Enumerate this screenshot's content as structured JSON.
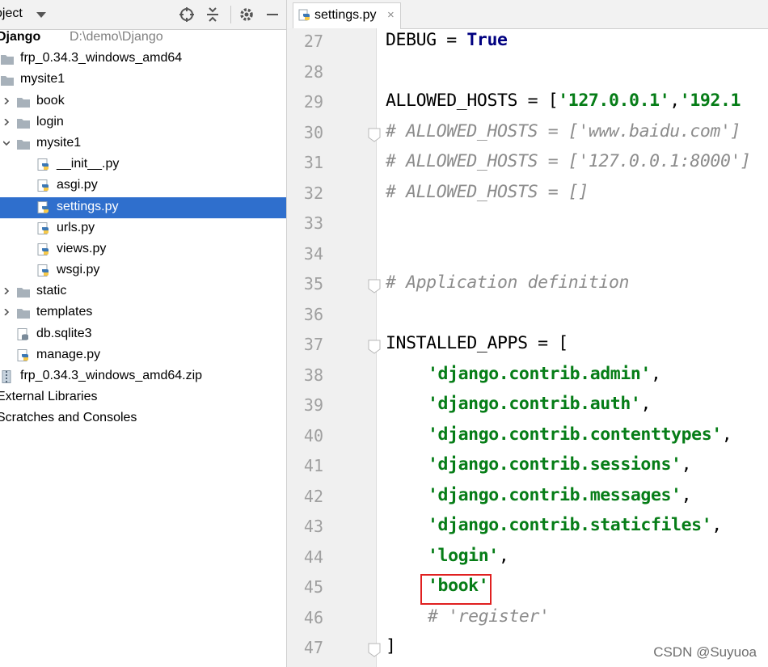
{
  "project_panel": {
    "title": "oject",
    "tree": [
      {
        "label": "Django",
        "hint": "D:\\demo\\Django",
        "level": 0,
        "type": "project",
        "arrow": "none"
      },
      {
        "label": "frp_0.34.3_windows_amd64",
        "level": 0,
        "type": "folder",
        "arrow": "none"
      },
      {
        "label": "mysite1",
        "level": 0,
        "type": "folder",
        "arrow": "none"
      },
      {
        "label": "book",
        "level": 1,
        "type": "folder",
        "arrow": "right"
      },
      {
        "label": "login",
        "level": 1,
        "type": "folder",
        "arrow": "right"
      },
      {
        "label": "mysite1",
        "level": 1,
        "type": "folder",
        "arrow": "down"
      },
      {
        "label": "__init__.py",
        "level": 2,
        "type": "python",
        "arrow": "none"
      },
      {
        "label": "asgi.py",
        "level": 2,
        "type": "python",
        "arrow": "none"
      },
      {
        "label": "settings.py",
        "level": 2,
        "type": "python",
        "arrow": "none",
        "selected": true
      },
      {
        "label": "urls.py",
        "level": 2,
        "type": "python",
        "arrow": "none"
      },
      {
        "label": "views.py",
        "level": 2,
        "type": "python",
        "arrow": "none"
      },
      {
        "label": "wsgi.py",
        "level": 2,
        "type": "python",
        "arrow": "none"
      },
      {
        "label": "static",
        "level": 1,
        "type": "folder",
        "arrow": "right"
      },
      {
        "label": "templates",
        "level": 1,
        "type": "folder",
        "arrow": "right"
      },
      {
        "label": "db.sqlite3",
        "level": 1,
        "type": "db",
        "arrow": "none"
      },
      {
        "label": "manage.py",
        "level": 1,
        "type": "python",
        "arrow": "none"
      },
      {
        "label": "frp_0.34.3_windows_amd64.zip",
        "level": 0,
        "type": "zip",
        "arrow": "none"
      },
      {
        "label": "External Libraries",
        "level": 0,
        "type": "none",
        "arrow": "none"
      },
      {
        "label": "Scratches and Consoles",
        "level": 0,
        "type": "none",
        "arrow": "none"
      }
    ]
  },
  "editor": {
    "tab_label": "settings.py",
    "tab_close": "×",
    "lines": [
      {
        "n": "27",
        "segs": [
          {
            "t": "DEBUG = ",
            "c": ""
          },
          {
            "t": "True",
            "c": "kw"
          }
        ]
      },
      {
        "n": "28",
        "segs": []
      },
      {
        "n": "29",
        "segs": [
          {
            "t": "ALLOWED_HOSTS = [",
            "c": ""
          },
          {
            "t": "'127.0.0.1'",
            "c": "str"
          },
          {
            "t": ",",
            "c": ""
          },
          {
            "t": "'192.1",
            "c": "str"
          }
        ]
      },
      {
        "n": "30",
        "fold": true,
        "segs": [
          {
            "t": "# ALLOWED_HOSTS = ['www.baidu.com']",
            "c": "cmt"
          }
        ]
      },
      {
        "n": "31",
        "segs": [
          {
            "t": "# ALLOWED_HOSTS = ['127.0.0.1:8000']",
            "c": "cmt"
          }
        ]
      },
      {
        "n": "32",
        "segs": [
          {
            "t": "# ALLOWED_HOSTS = []",
            "c": "cmt"
          }
        ]
      },
      {
        "n": "33",
        "segs": []
      },
      {
        "n": "34",
        "segs": []
      },
      {
        "n": "35",
        "fold": true,
        "segs": [
          {
            "t": "# Application definition",
            "c": "cmt"
          }
        ]
      },
      {
        "n": "36",
        "segs": []
      },
      {
        "n": "37",
        "fold": true,
        "segs": [
          {
            "t": "INSTALLED_APPS = [",
            "c": ""
          }
        ]
      },
      {
        "n": "38",
        "indent": true,
        "segs": [
          {
            "t": "'django.contrib.admin'",
            "c": "str"
          },
          {
            "t": ",",
            "c": ""
          }
        ]
      },
      {
        "n": "39",
        "indent": true,
        "segs": [
          {
            "t": "'django.contrib.auth'",
            "c": "str"
          },
          {
            "t": ",",
            "c": ""
          }
        ]
      },
      {
        "n": "40",
        "indent": true,
        "segs": [
          {
            "t": "'django.contrib.contenttypes'",
            "c": "str"
          },
          {
            "t": ",",
            "c": ""
          }
        ]
      },
      {
        "n": "41",
        "indent": true,
        "segs": [
          {
            "t": "'django.contrib.sessions'",
            "c": "str"
          },
          {
            "t": ",",
            "c": ""
          }
        ]
      },
      {
        "n": "42",
        "indent": true,
        "segs": [
          {
            "t": "'django.contrib.messages'",
            "c": "str"
          },
          {
            "t": ",",
            "c": ""
          }
        ]
      },
      {
        "n": "43",
        "indent": true,
        "segs": [
          {
            "t": "'django.contrib.staticfiles'",
            "c": "str"
          },
          {
            "t": ",",
            "c": ""
          }
        ]
      },
      {
        "n": "44",
        "indent": true,
        "segs": [
          {
            "t": "'login'",
            "c": "str"
          },
          {
            "t": ",",
            "c": ""
          }
        ]
      },
      {
        "n": "45",
        "indent": true,
        "highlight": true,
        "segs": [
          {
            "t": "'book'",
            "c": "str"
          }
        ]
      },
      {
        "n": "46",
        "indent": true,
        "segs": [
          {
            "t": "# 'register'",
            "c": "cmt"
          }
        ]
      },
      {
        "n": "47",
        "fold": true,
        "segs": [
          {
            "t": "]",
            "c": ""
          }
        ]
      }
    ]
  },
  "watermark": "CSDN @Suyuoa",
  "colors": {
    "selection": "#2f6fcd",
    "string": "#067d17",
    "keyword": "#000080",
    "comment": "#8c8c8c",
    "highlight_box": "#e02020"
  }
}
